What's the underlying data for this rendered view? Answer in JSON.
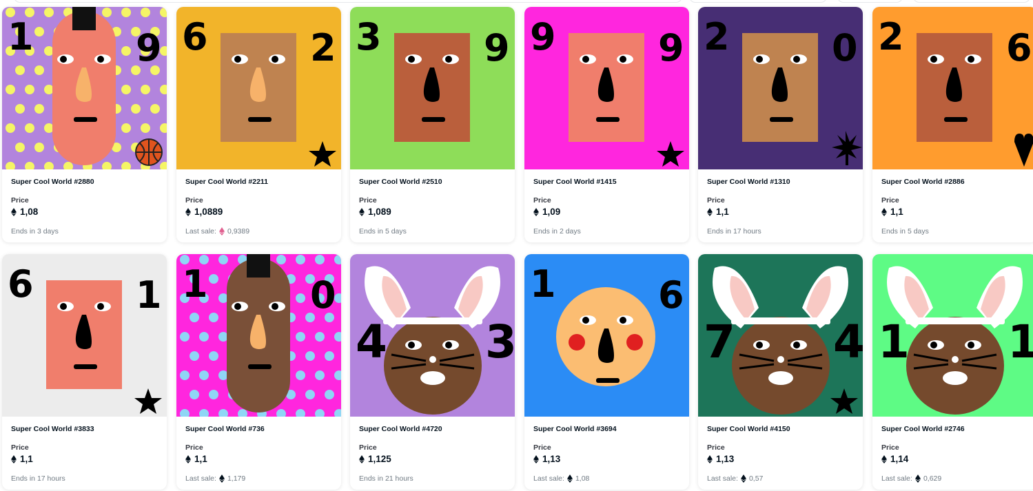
{
  "cards": [
    {
      "name": "Super Cool World #2880",
      "price_label": "Price",
      "price": "1,08",
      "footer_text": "Ends in 3 days",
      "footer_value": "",
      "footer_eth": "",
      "bg": "#b284dd",
      "dots": "#f5f566",
      "left_num": "1",
      "right_num": "9",
      "face": "#f07e6c",
      "symbol": "basketball",
      "bunny": false
    },
    {
      "name": "Super Cool World #2211",
      "price_label": "Price",
      "price": "1,0889",
      "footer_text": "Last sale:",
      "footer_value": "0,9389",
      "footer_eth": "#e06090",
      "bg": "#f2b42a",
      "dots": "",
      "left_num": "6",
      "right_num": "2",
      "face": "#bf8350",
      "symbol": "star",
      "bunny": false
    },
    {
      "name": "Super Cool World #2510",
      "price_label": "Price",
      "price": "1,089",
      "footer_text": "Ends in 5 days",
      "footer_value": "",
      "footer_eth": "",
      "bg": "#8edd59",
      "dots": "",
      "left_num": "3",
      "right_num": "9",
      "face": "#ba5f3c",
      "symbol": "",
      "bunny": false
    },
    {
      "name": "Super Cool World #1415",
      "price_label": "Price",
      "price": "1,09",
      "footer_text": "Ends in 2 days",
      "footer_value": "",
      "footer_eth": "",
      "bg": "#ff26de",
      "dots": "",
      "left_num": "9",
      "right_num": "9",
      "face": "#f07e6c",
      "symbol": "star",
      "bunny": false
    },
    {
      "name": "Super Cool World #1310",
      "price_label": "Price",
      "price": "1,1",
      "footer_text": "Ends in 17 hours",
      "footer_value": "",
      "footer_eth": "",
      "bg": "#472e74",
      "dots": "",
      "left_num": "2",
      "right_num": "0",
      "face": "#bf8350",
      "symbol": "leaf",
      "bunny": false
    },
    {
      "name": "Super Cool World #2886",
      "price_label": "Price",
      "price": "1,1",
      "footer_text": "Ends in 5 days",
      "footer_value": "",
      "footer_eth": "",
      "bg": "#ff9c2e",
      "dots": "",
      "left_num": "2",
      "right_num": "6",
      "face": "#ba5f3c",
      "symbol": "heart",
      "bunny": false
    },
    {
      "name": "Super Cool World #3833",
      "price_label": "Price",
      "price": "1,1",
      "footer_text": "Ends in 17 hours",
      "footer_value": "",
      "footer_eth": "",
      "bg": "#ececec",
      "dots": "",
      "left_num": "6",
      "right_num": "1",
      "face": "#f07e6c",
      "symbol": "star",
      "bunny": false
    },
    {
      "name": "Super Cool World #736",
      "price_label": "Price",
      "price": "1,1",
      "footer_text": "Last sale:",
      "footer_value": "1,179",
      "footer_eth": "#04111d",
      "bg": "#ff26de",
      "dots": "#8fd6f5",
      "left_num": "1",
      "right_num": "0",
      "face": "#7a5038",
      "symbol": "",
      "bunny": false
    },
    {
      "name": "Super Cool World #4720",
      "price_label": "Price",
      "price": "1,125",
      "footer_text": "Ends in 21 hours",
      "footer_value": "",
      "footer_eth": "",
      "bg": "#b284dd",
      "dots": "",
      "left_num": "4",
      "right_num": "3",
      "face": "#754a2d",
      "symbol": "",
      "bunny": true
    },
    {
      "name": "Super Cool World #3694",
      "price_label": "Price",
      "price": "1,13",
      "footer_text": "Last sale:",
      "footer_value": "1,08",
      "footer_eth": "#04111d",
      "bg": "#2b8cf5",
      "dots": "",
      "left_num": "1",
      "right_num": "6",
      "face": "#fbbd72",
      "symbol": "",
      "bunny": false
    },
    {
      "name": "Super Cool World #4150",
      "price_label": "Price",
      "price": "1,13",
      "footer_text": "Last sale:",
      "footer_value": "0,57",
      "footer_eth": "#04111d",
      "bg": "#1d7559",
      "dots": "",
      "left_num": "7",
      "right_num": "4",
      "face": "#754a2d",
      "symbol": "star",
      "bunny": true
    },
    {
      "name": "Super Cool World #2746",
      "price_label": "Price",
      "price": "1,14",
      "footer_text": "Last sale:",
      "footer_value": "0,629",
      "footer_eth": "#04111d",
      "bg": "#5efb85",
      "dots": "",
      "left_num": "1",
      "right_num": "1",
      "face": "#754a2d",
      "symbol": "",
      "bunny": true
    }
  ]
}
